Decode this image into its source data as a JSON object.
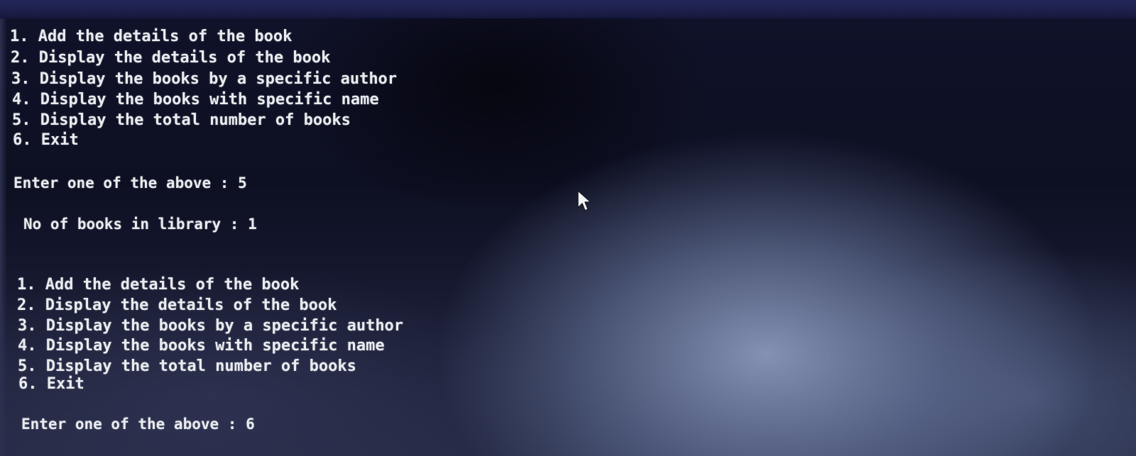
{
  "menu_block_1": {
    "items": [
      "1. Add the details of the book",
      "2. Display the details of the book",
      "3. Display the books by a specific author",
      "4. Display the books with specific name",
      "5. Display the total number of books",
      "6. Exit"
    ],
    "prompt": "Enter one of the above : 5"
  },
  "result": "No of books in library : 1",
  "menu_block_2": {
    "items": [
      "1. Add the details of the book",
      "2. Display the details of the book",
      "3. Display the books by a specific author",
      "4. Display the books with specific name",
      "5. Display the total number of books",
      "6. Exit"
    ],
    "prompt": "Enter one of the above : 6"
  },
  "icons": {
    "cursor": "mouse-pointer-icon"
  }
}
